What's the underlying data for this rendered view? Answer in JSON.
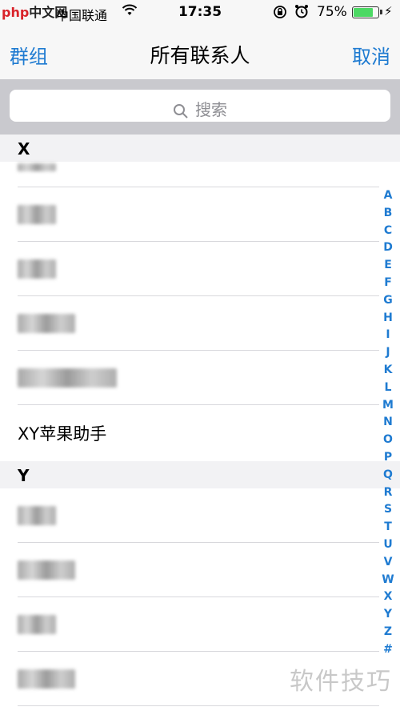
{
  "statusbar": {
    "logo_left": "php",
    "logo_right": "中文网",
    "carrier": "中国联通",
    "time": "17:35",
    "battery_percent": "75%",
    "battery_level": 0.75
  },
  "navbar": {
    "left_label": "群组",
    "title": "所有联系人",
    "right_label": "取消"
  },
  "search": {
    "placeholder": "搜索"
  },
  "sections": [
    {
      "letter": "X"
    },
    {
      "letter": "Y"
    }
  ],
  "contacts": {
    "visible_name": "XY苹果助手"
  },
  "index_letters": [
    "A",
    "B",
    "C",
    "D",
    "E",
    "F",
    "G",
    "H",
    "I",
    "J",
    "K",
    "L",
    "M",
    "N",
    "O",
    "P",
    "Q",
    "R",
    "S",
    "T",
    "U",
    "V",
    "W",
    "X",
    "Y",
    "Z",
    "#"
  ],
  "watermark": "软件技巧",
  "colors": {
    "accent": "#1f7bd1",
    "battery": "#4cd964"
  }
}
